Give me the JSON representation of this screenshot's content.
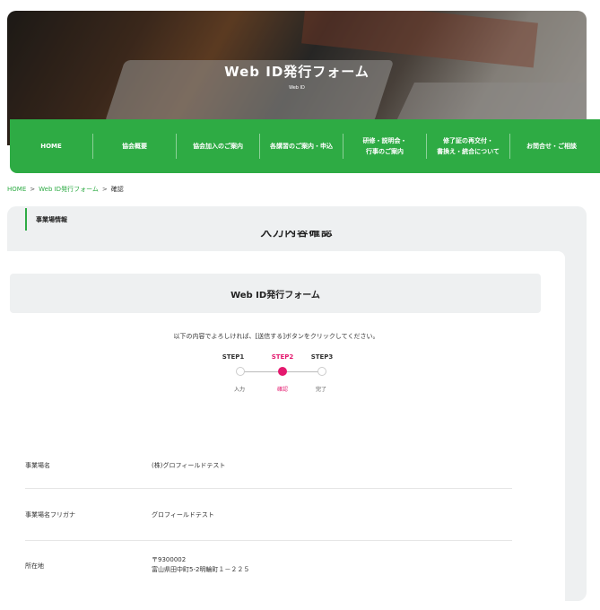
{
  "hero": {
    "title": "Web ID発行フォーム",
    "subtitle": "Web ID"
  },
  "nav": {
    "items": [
      {
        "label": "HOME"
      },
      {
        "label": "協会概要"
      },
      {
        "label": "協会加入のご案内"
      },
      {
        "label": "各講習のご案内・申込"
      },
      {
        "label": "研修・説明会・\n行事のご案内"
      },
      {
        "label": "修了証の再交付・\n書換え・統合について"
      },
      {
        "label": "お問合せ・ご相談"
      }
    ]
  },
  "breadcrumb": {
    "home": "HOME",
    "form": "Web ID発行フォーム",
    "current": "確認",
    "separator": ">"
  },
  "page": {
    "heading": "入力内容確認",
    "form_title": "Web ID発行フォーム",
    "intro": "以下の内容でよろしければ、[送信する]ボタンをクリックしてください。"
  },
  "steps": {
    "items": [
      {
        "label": "STEP1",
        "caption": "入力",
        "active": false
      },
      {
        "label": "STEP2",
        "caption": "確認",
        "active": true
      },
      {
        "label": "STEP3",
        "caption": "完了",
        "active": false
      }
    ]
  },
  "section": {
    "title": "事業場情報"
  },
  "fields": [
    {
      "label": "事業場名",
      "value": "(株)グロフィールドテスト"
    },
    {
      "label": "事業場名フリガナ",
      "value": "グロフィールドテスト"
    },
    {
      "label": "所在地",
      "postal": "〒9300002",
      "address": "富山県田中町5-2明輪町１－２２５"
    }
  ],
  "colors": {
    "accent_green": "#2eab44",
    "step_active": "#e4196e",
    "panel_gray": "#eef0f1"
  }
}
